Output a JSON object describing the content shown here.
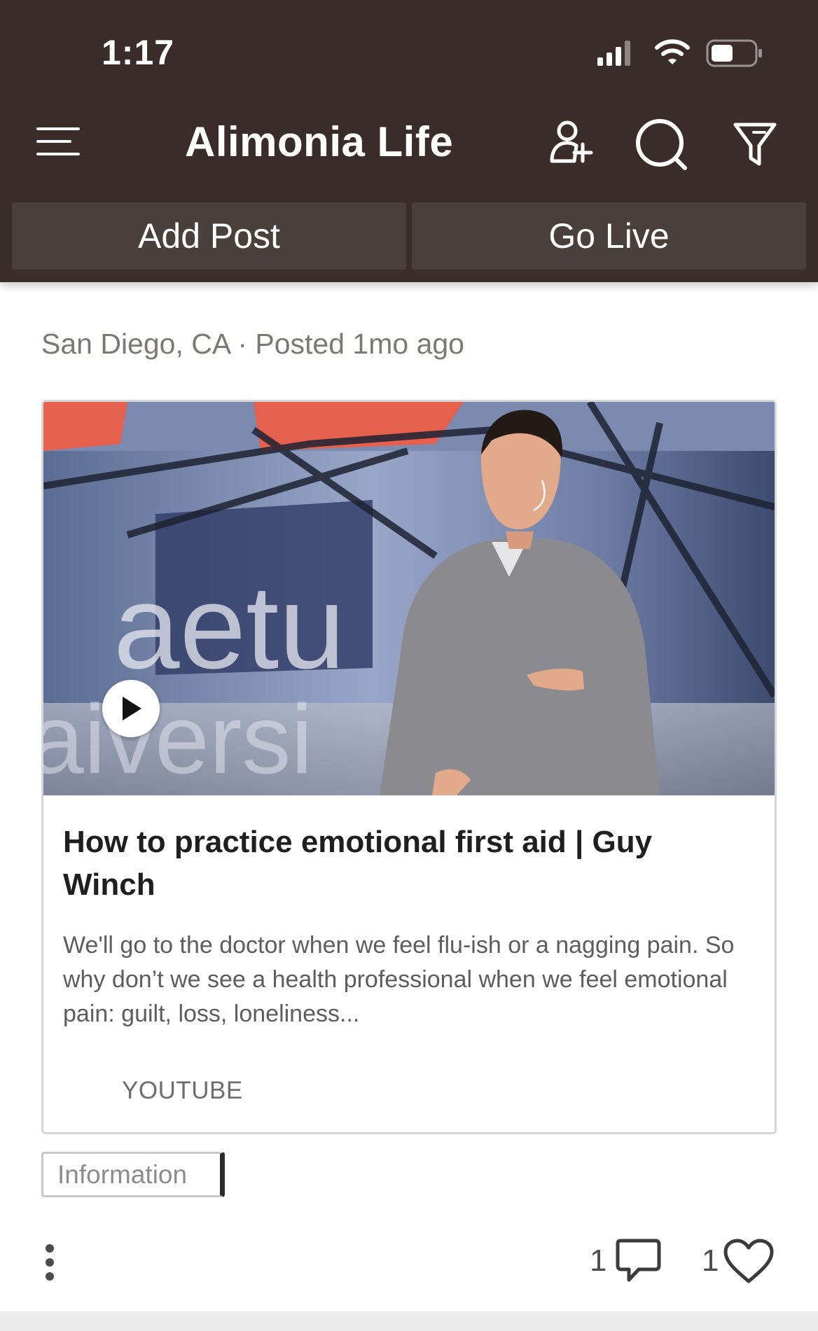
{
  "status_bar": {
    "time": "1:17"
  },
  "header": {
    "title": "Alimonia Life",
    "icons": [
      "menu-icon",
      "add-user-icon",
      "search-icon",
      "filter-icon"
    ],
    "buttons": {
      "add_post": "Add Post",
      "go_live": "Go Live"
    },
    "background": "#3a2d29"
  },
  "post": {
    "meta": "San Diego, CA · Posted 1mo ago",
    "card": {
      "title": "How to practice emotional first aid | Guy Winch",
      "description": "We'll go to the doctor when we feel flu-ish or a nagging pain. So why don’t we see a health professional when we feel emotional pain: guilt, loss, loneliness...",
      "source": "YOUTUBE"
    },
    "tag": "Information",
    "comments_count": "1",
    "likes_count": "1"
  }
}
